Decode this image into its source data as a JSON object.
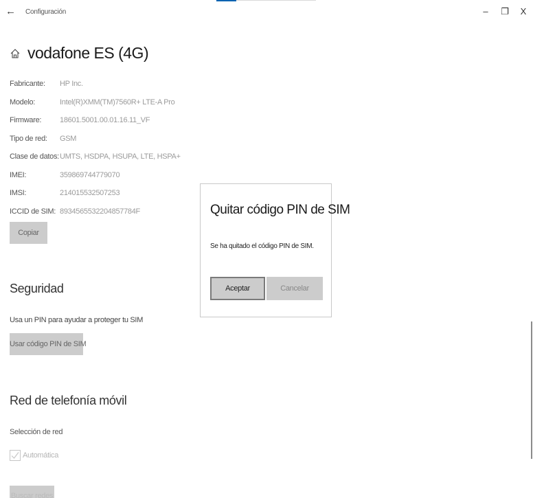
{
  "window": {
    "title": "Configuración",
    "back_glyph": "←",
    "minimize_glyph": "–",
    "restore_glyph": "❐",
    "close_glyph": "X"
  },
  "header": {
    "icon": "home-icon",
    "network_name": "vodafone ES (4G)"
  },
  "properties": [
    {
      "label": "Fabricante:",
      "value": "HP Inc."
    },
    {
      "label": "Modelo:",
      "value": "Intel(R)XMM(TM)7560R+ LTE-A Pro"
    },
    {
      "label": "Firmware:",
      "value": "18601.5001.00.01.16.11_VF"
    },
    {
      "label": "Tipo de red:",
      "value": "GSM"
    },
    {
      "label": "Clase de datos:",
      "value": "UMTS, HSDPA, HSUPA, LTE, HSPA+"
    },
    {
      "label": "IMEI:",
      "value": "359869744779070"
    },
    {
      "label": "IMSI:",
      "value": "214015532507253"
    },
    {
      "label": "ICCID de SIM:",
      "value": "8934565532204857784F"
    }
  ],
  "copy_button": "Copiar",
  "security": {
    "heading": "Seguridad",
    "description": "Usa un PIN para ayudar a proteger tu SIM",
    "pin_button": "Usar código PIN de SIM"
  },
  "mobile_network": {
    "heading": "Red de telefonía móvil",
    "selection_label": "Selección de red",
    "automatic_label": "Automática",
    "automatic_checked": true,
    "search_button": "Buscar redes"
  },
  "dialog": {
    "title": "Quitar código PIN de SIM",
    "message": "Se ha quitado el código PIN de SIM.",
    "accept": "Aceptar",
    "cancel": "Cancelar"
  }
}
